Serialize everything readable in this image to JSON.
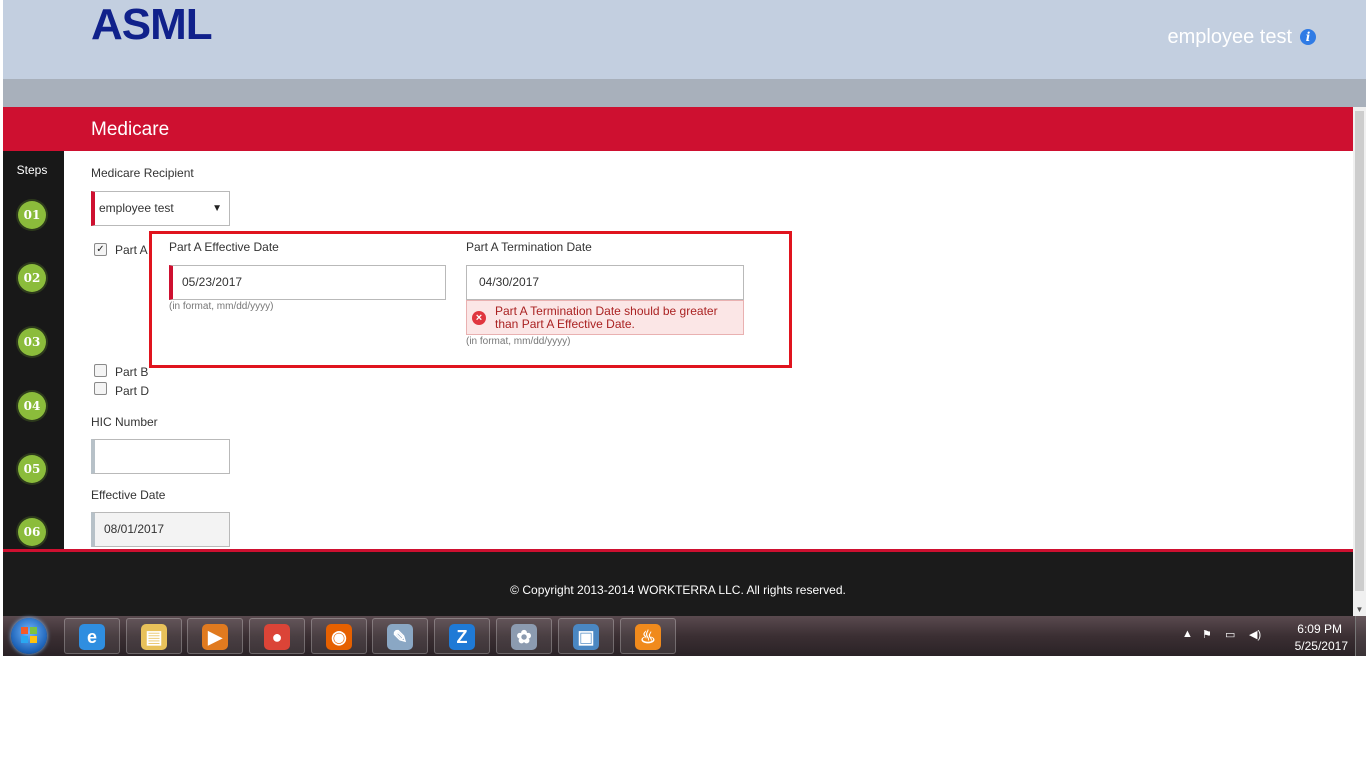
{
  "header": {
    "logo": "ASML",
    "user_name": "employee test",
    "info_icon": "i"
  },
  "page": {
    "title": "Medicare"
  },
  "steps": {
    "label": "Steps",
    "items": [
      "01",
      "02",
      "03",
      "04",
      "05",
      "06"
    ]
  },
  "form": {
    "recipient_label": "Medicare Recipient",
    "recipient_value": "employee test",
    "part_a_label": "Part A",
    "part_a_checked": true,
    "part_b_label": "Part B",
    "part_d_label": "Part D",
    "part_a_effective_label": "Part A Effective Date",
    "part_a_effective_value": "05/23/2017",
    "part_a_effective_hint": "(in format, mm/dd/yyyy)",
    "part_a_termination_label": "Part A Termination Date",
    "part_a_termination_value": "04/30/2017",
    "part_a_termination_error": "Part A Termination Date should be greater than Part A Effective Date.",
    "part_a_termination_hint": "(in format, mm/dd/yyyy)",
    "hic_label": "HIC Number",
    "hic_value": "",
    "effective_date_label": "Effective Date",
    "effective_date_value": "08/01/2017"
  },
  "footer": {
    "copyright": "© Copyright 2013-2014 WORKTERRA LLC. All rights reserved."
  },
  "taskbar": {
    "apps": [
      {
        "name": "internet-explorer-icon",
        "glyph": "e",
        "color": "#2f8ee0"
      },
      {
        "name": "file-explorer-icon",
        "glyph": "▤",
        "color": "#e8c15a"
      },
      {
        "name": "media-player-icon",
        "glyph": "▶",
        "color": "#e07a1f"
      },
      {
        "name": "chrome-icon",
        "glyph": "●",
        "color": "#db4437"
      },
      {
        "name": "firefox-icon",
        "glyph": "◉",
        "color": "#e66000"
      },
      {
        "name": "notepad-icon",
        "glyph": "✎",
        "color": "#8aa7c4"
      },
      {
        "name": "z-app-icon",
        "glyph": "Z",
        "color": "#1f7ad6"
      },
      {
        "name": "paint-icon",
        "glyph": "✿",
        "color": "#8c9bb0"
      },
      {
        "name": "picture-viewer-icon",
        "glyph": "▣",
        "color": "#4a87c2"
      },
      {
        "name": "flame-app-icon",
        "glyph": "♨",
        "color": "#f08a1c"
      }
    ],
    "clock_time": "6:09 PM",
    "clock_date": "5/25/2017"
  },
  "colors": {
    "brand_red": "#ce1030",
    "header_bg": "#c3cfe0",
    "logo_blue": "#10218b",
    "step_green": "#8bbc3b"
  }
}
